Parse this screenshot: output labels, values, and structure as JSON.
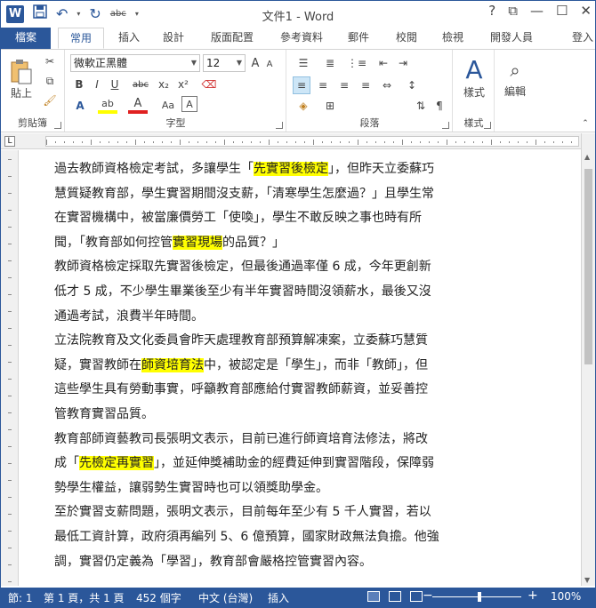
{
  "app": {
    "title": "文件1 - Word",
    "logo_letter": "W"
  },
  "qat": {
    "save_icon": "save-icon",
    "undo_icon": "undo-icon",
    "redo_icon": "redo-icon",
    "spelling": "abc"
  },
  "window_buttons": {
    "help": "?",
    "ribbon_options": "⧉",
    "minimize": "—",
    "maximize": "☐",
    "close": "✕"
  },
  "tabs": [
    {
      "label": "檔案"
    },
    {
      "label": "常用"
    },
    {
      "label": "插入"
    },
    {
      "label": "設計"
    },
    {
      "label": "版面配置"
    },
    {
      "label": "參考資料"
    },
    {
      "label": "郵件"
    },
    {
      "label": "校閱"
    },
    {
      "label": "檢視"
    },
    {
      "label": "開發人員"
    }
  ],
  "login": "登入",
  "ribbon": {
    "clipboard": {
      "label": "剪貼簿",
      "paste": "貼上"
    },
    "font": {
      "label": "字型",
      "family": "微軟正黑體",
      "size": "12",
      "bold": "B",
      "italic": "I",
      "underline": "U",
      "strike": "abc",
      "sub": "x₂",
      "sup": "x²",
      "grow": "A",
      "shrink": "A",
      "case": "Aa",
      "highlight": "ab",
      "color": "A"
    },
    "paragraph": {
      "label": "段落"
    },
    "styles": {
      "label": "樣式",
      "button": "樣式"
    },
    "editing": {
      "label": "編輯",
      "button": "編輯"
    }
  },
  "document": {
    "paragraphs": [
      {
        "lines": [
          [
            {
              "t": "過去教師資格檢定考試，多讓學生「"
            },
            {
              "t": "先實習後檢定",
              "hl": true
            },
            {
              "t": "」，但昨天立委蘇巧"
            }
          ],
          [
            {
              "t": "慧質疑教育部，學生實習期間沒支薪，「清寒學生怎麼過？」且學生常"
            }
          ],
          [
            {
              "t": "在實習機構中，被當廉價勞工「使喚」，學生不敢反映之事也時有所"
            }
          ],
          [
            {
              "t": "聞，「教育部如何控管"
            },
            {
              "t": "實習現場",
              "hl": true
            },
            {
              "t": "的品質？」"
            }
          ]
        ]
      },
      {
        "lines": [
          [
            {
              "t": "教師資格檢定採取先實習後檢定，但最後通過率僅 6 成，今年更創新"
            }
          ],
          [
            {
              "t": "低才 5 成，不少學生畢業後至少有半年實習時間沒領薪水，最後又沒"
            }
          ],
          [
            {
              "t": "通過考試，浪費半年時間。"
            }
          ]
        ]
      },
      {
        "lines": [
          [
            {
              "t": "立法院教育及文化委員會昨天處理教育部預算解凍案，立委蘇巧慧質"
            }
          ],
          [
            {
              "t": "疑，實習教師在"
            },
            {
              "t": "師資培育法",
              "hl": true
            },
            {
              "t": "中，被認定是「學生」，而非「教師」，但"
            }
          ],
          [
            {
              "t": "這些學生具有勞動事實，呼籲教育部應給付實習教師薪資，並妥善控"
            }
          ],
          [
            {
              "t": "管教育實習品質。"
            }
          ]
        ]
      },
      {
        "lines": [
          [
            {
              "t": "教育部師資藝教司長張明文表示，目前已進行師資培育法修法，將改"
            }
          ],
          [
            {
              "t": "成「"
            },
            {
              "t": "先檢定再實習",
              "hl": true
            },
            {
              "t": "」，並延伸獎補助金的經費延伸到實習階段，保障弱"
            }
          ],
          [
            {
              "t": "勢學生權益，讓弱勢生實習時也可以領獎助學金。"
            }
          ]
        ]
      },
      {
        "lines": [
          [
            {
              "t": "至於實習支薪問題，張明文表示，目前每年至少有 5 千人實習，若以"
            }
          ],
          [
            {
              "t": "最低工資計算，政府須再編列 5、6 億預算，國家財政無法負擔。他強"
            }
          ],
          [
            {
              "t": "調，實習仍定義為「學習」，教育部會嚴格控管實習內容。"
            }
          ]
        ]
      }
    ]
  },
  "status": {
    "section": "節: 1",
    "page": "第 1 頁，共 1 頁",
    "words": "452 個字",
    "language": "中文 (台灣)",
    "mode": "插入",
    "zoom": "100%",
    "zoom_level": 1.0
  }
}
